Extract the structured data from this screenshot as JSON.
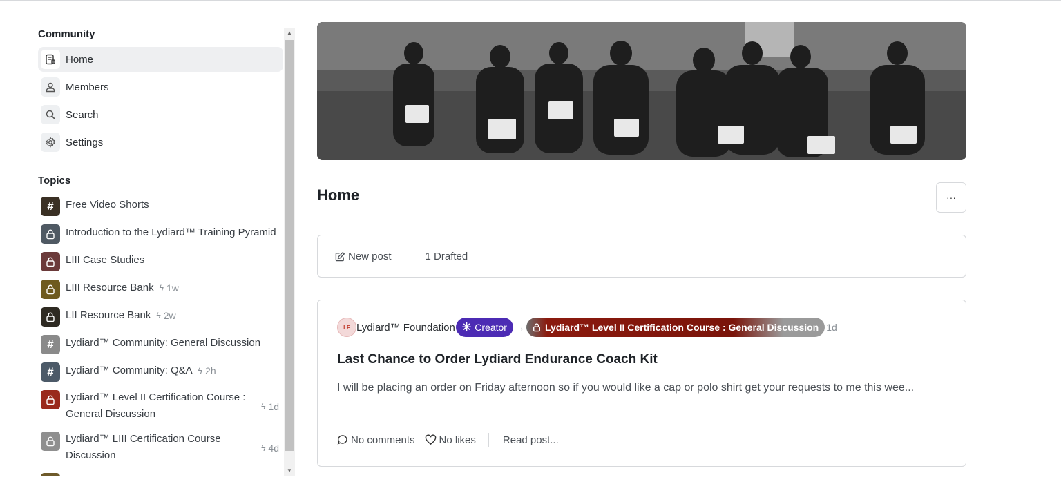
{
  "sidebar": {
    "community_title": "Community",
    "nav": [
      {
        "label": "Home",
        "icon": "document-icon",
        "active": true
      },
      {
        "label": "Members",
        "icon": "user-icon"
      },
      {
        "label": "Search",
        "icon": "search-icon"
      },
      {
        "label": "Settings",
        "icon": "gear-icon"
      }
    ],
    "topics_title": "Topics",
    "topics": [
      {
        "label": "Free Video Shorts",
        "icon": "hash-icon",
        "bg": "#3a3024"
      },
      {
        "label": "Introduction to the Lydiard™ Training Pyramid",
        "icon": "lock-icon",
        "bg": "#4f5963"
      },
      {
        "label": "LIII Case Studies",
        "icon": "lock-icon",
        "bg": "#6b3a3a"
      },
      {
        "label": "LIII Resource Bank",
        "icon": "lock-icon",
        "bg": "#6e5a1e",
        "activity": "1w"
      },
      {
        "label": "LII Resource Bank",
        "icon": "lock-icon",
        "bg": "#2e2a22",
        "activity": "2w"
      },
      {
        "label": "Lydiard™ Community: General Discussion",
        "icon": "hash-icon",
        "bg": "#8a8a8a"
      },
      {
        "label": "Lydiard™ Community: Q&A",
        "icon": "hash-icon",
        "bg": "#4c5a68",
        "activity": "2h"
      },
      {
        "label_line1": "Lydiard™ Level II Certification Course :",
        "label_line2": "General Discussion",
        "icon": "lock-icon",
        "bg": "#9a2a1c",
        "activity": "1d"
      },
      {
        "label_line1": "Lydiard™ LIII Certification Course",
        "label_line2": "Discussion",
        "icon": "lock-icon",
        "bg": "#8f8f8f",
        "activity": "4d"
      }
    ]
  },
  "main": {
    "page_title": "Home",
    "more_label": "···",
    "composer": {
      "new_post": "New post",
      "drafted": "1 Drafted"
    },
    "post": {
      "avatar_initials": "LF",
      "author": "Lydiard™ Foundation",
      "badge": "Creator",
      "topic": "Lydiard™ Level II Certification Course : General Discussion",
      "age": "1d",
      "title": "Last Chance to Order Lydiard Endurance Coach Kit",
      "excerpt": "I will be placing an order on Friday afternoon so if you would like a cap or polo shirt get your requests to me this wee...",
      "comments": "No comments",
      "likes": "No likes",
      "read": "Read post..."
    }
  },
  "colors": {
    "creator_badge": "#4c2bb4",
    "topic_chip": "#8b1a0e",
    "active_nav": "#eeeff1"
  }
}
